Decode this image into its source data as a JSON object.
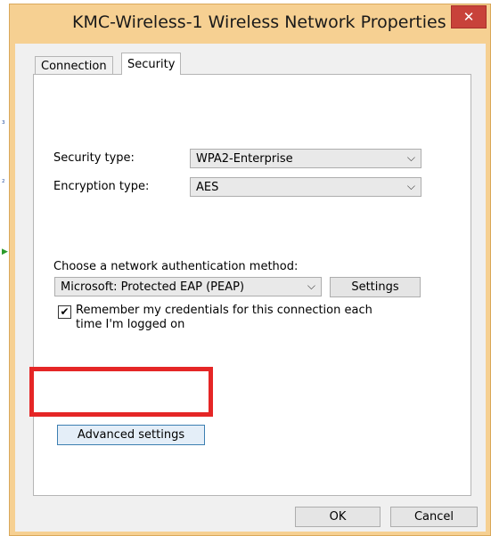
{
  "window": {
    "title": "KMC-Wireless-1 Wireless Network Properties",
    "close_glyph": "✕"
  },
  "tabs": [
    {
      "label": "Connection",
      "active": false
    },
    {
      "label": "Security",
      "active": true
    }
  ],
  "security_type": {
    "label": "Security type:",
    "value": "WPA2-Enterprise"
  },
  "encryption_type": {
    "label": "Encryption type:",
    "value": "AES"
  },
  "auth": {
    "label": "Choose a network authentication method:",
    "value": "Microsoft: Protected EAP (PEAP)",
    "settings_label": "Settings"
  },
  "remember": {
    "checked": true,
    "line1": "Remember my credentials for this connection each",
    "line2": "time I'm logged on"
  },
  "advanced_label": "Advanced settings",
  "footer": {
    "ok_label": "OK",
    "cancel_label": "Cancel"
  },
  "icons": {
    "chevron": "chevron-down-icon",
    "check": "checkmark-icon",
    "close": "close-icon"
  },
  "colors": {
    "title_bg": "#f6d092",
    "close_bg": "#c8423a",
    "highlight": "#e52626"
  }
}
